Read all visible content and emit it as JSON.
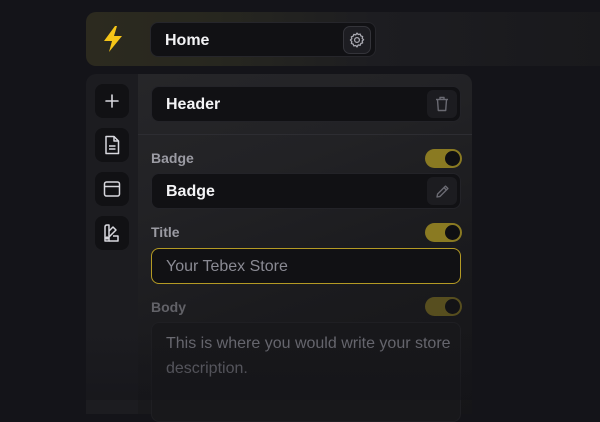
{
  "topbar": {
    "logo_icon": "lightning-bolt-icon",
    "page_select": {
      "value": "Home"
    },
    "settings_icon": "gear-icon"
  },
  "rail": {
    "items": [
      {
        "icon": "plus-icon"
      },
      {
        "icon": "document-icon"
      },
      {
        "icon": "browser-window-icon"
      },
      {
        "icon": "palette-swatch-icon"
      }
    ]
  },
  "panel": {
    "section_select": {
      "value": "Header",
      "action_icon": "trash-icon"
    },
    "badge": {
      "label": "Badge",
      "enabled": true,
      "value": "Badge",
      "action_icon": "pencil-icon"
    },
    "title": {
      "label": "Title",
      "enabled": true,
      "placeholder": "Your Tebex Store"
    },
    "body": {
      "label": "Body",
      "enabled": true,
      "placeholder": "This is where you would write your store description."
    }
  },
  "colors": {
    "accent": "#f5c518",
    "toggle_on": "#8a7a22",
    "background": "#141419"
  }
}
